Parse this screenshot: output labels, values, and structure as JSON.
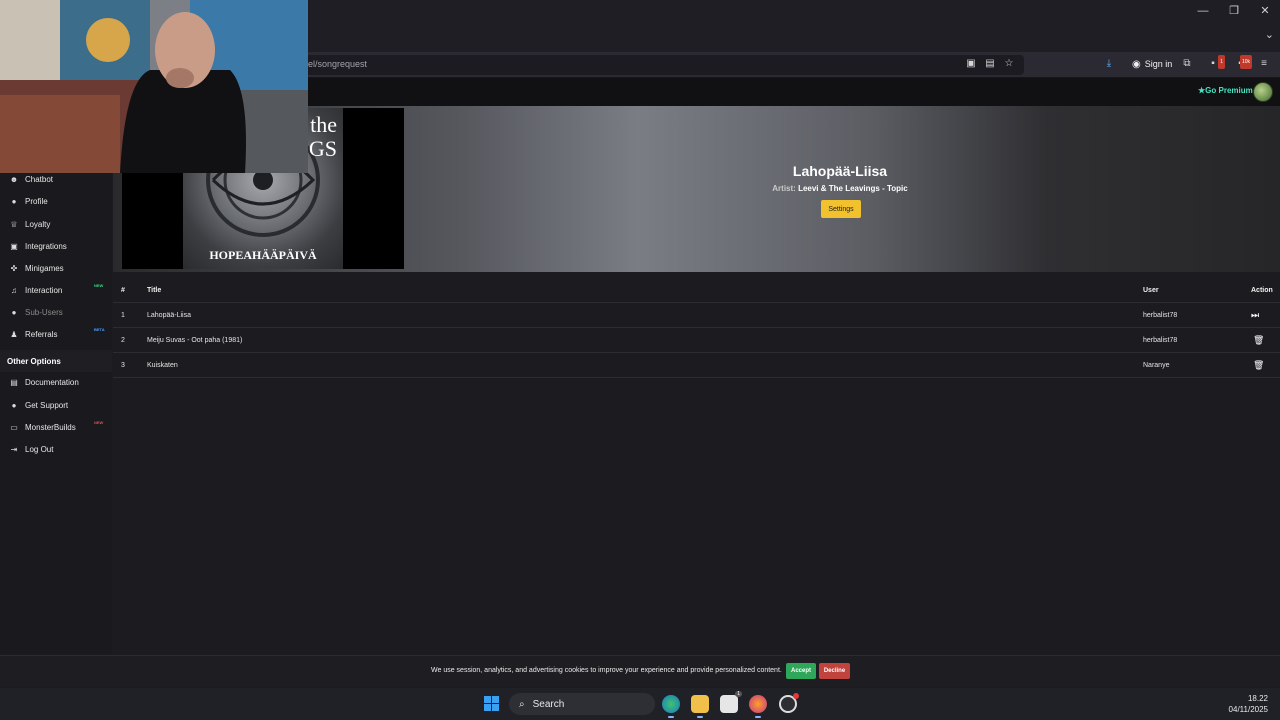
{
  "browser": {
    "url": "el/songrequest",
    "signin_label": "Sign in",
    "ext_badge_1": "1",
    "ext_badge_2": "10k"
  },
  "site": {
    "premium_label": "Go Premium"
  },
  "sidebar": {
    "items": [
      {
        "label": "Chatbot",
        "icon": "robot-icon"
      },
      {
        "label": "Profile",
        "icon": "user-icon"
      },
      {
        "label": "Loyalty",
        "icon": "trophy-icon"
      },
      {
        "label": "Integrations",
        "icon": "puzzle-icon"
      },
      {
        "label": "Minigames",
        "icon": "gamepad-icon"
      },
      {
        "label": "Interaction",
        "icon": "music-icon",
        "badge": "NEW"
      },
      {
        "label": "Sub-Users",
        "icon": "users-icon"
      },
      {
        "label": "Referrals",
        "icon": "referral-icon",
        "badge": "BETA"
      }
    ],
    "section_title": "Other Options",
    "other_items": [
      {
        "label": "Documentation",
        "icon": "book-icon"
      },
      {
        "label": "Get Support",
        "icon": "help-icon"
      },
      {
        "label": "MonsterBuilds",
        "icon": "laptop-icon",
        "badge": "NEW"
      },
      {
        "label": "Log Out",
        "icon": "logout-icon"
      }
    ]
  },
  "now_playing": {
    "title": "Lahopää-Liisa",
    "artist_label": "Artist:",
    "artist": "Leevi & The Leavings - Topic",
    "settings_label": "Settings",
    "album_text_top_1": "the",
    "album_text_top_2": "GS",
    "album_text_bottom": "HOPEAHÄÄPÄIVÄ"
  },
  "queue": {
    "headers": {
      "num": "#",
      "title": "Title",
      "user": "User",
      "action": "Action"
    },
    "rows": [
      {
        "num": "1",
        "title": "Lahopää-Liisa",
        "user": "herbalist78",
        "action": "skip"
      },
      {
        "num": "2",
        "title": "Meiju Suvas - Oot paha (1981)",
        "user": "herbalist78",
        "action": "delete"
      },
      {
        "num": "3",
        "title": "Kuiskaten",
        "user": "Naranye",
        "action": "delete"
      }
    ]
  },
  "cookie": {
    "text": "We use session, analytics, and advertising cookies to improve your experience and provide personalized content.",
    "accept": "Accept",
    "decline": "Decline"
  },
  "taskbar": {
    "search_label": "Search",
    "time": "18.22",
    "date": "04/11/2025",
    "store_badge": "1"
  },
  "colors": {
    "accent": "#47e6c1",
    "settings_button": "#f2c12e",
    "accept": "#2ea75a",
    "decline": "#c0433e"
  }
}
